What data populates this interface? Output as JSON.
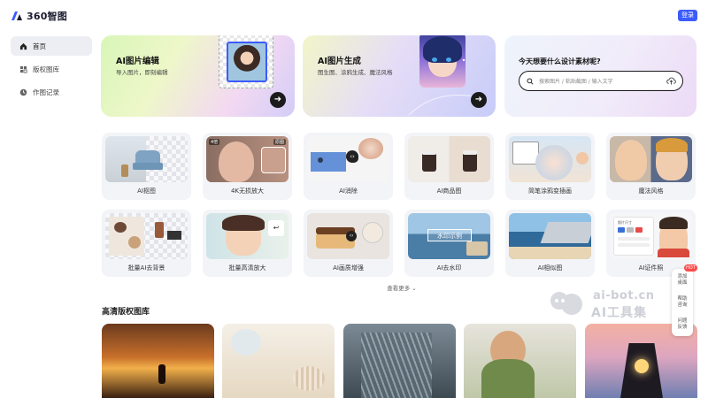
{
  "header": {
    "logo_text": "360智图",
    "login_label": "登录"
  },
  "sidebar": {
    "items": [
      {
        "label": "首页",
        "icon": "home-icon",
        "active": true
      },
      {
        "label": "版权图库",
        "icon": "grid-icon",
        "active": false
      },
      {
        "label": "作图记录",
        "icon": "clock-icon",
        "active": false
      }
    ]
  },
  "hero": {
    "edit": {
      "title": "AI图片编辑",
      "subtitle": "导入图片，即刻编辑"
    },
    "generate": {
      "title": "AI图片生成",
      "subtitle": "图生图、涂鸦生成、魔法风格"
    },
    "search": {
      "title": "今天想要什么设计素材呢?",
      "placeholder": "搜索图片 / 粘贴截图 / 输入文字"
    }
  },
  "tools": [
    {
      "label": "AI抠图"
    },
    {
      "label": "4K无损放大",
      "badge_left": "4倍",
      "badge_right": "原图"
    },
    {
      "label": "AI消除"
    },
    {
      "label": "AI商品图"
    },
    {
      "label": "简笔涂鸦变插画"
    },
    {
      "label": "魔法风格"
    },
    {
      "label": "批量AI去背景"
    },
    {
      "label": "批量高清放大"
    },
    {
      "label": "AI画质增强"
    },
    {
      "label": "AI去水印",
      "watermark_text": "水印示例"
    },
    {
      "label": "AI相似图"
    },
    {
      "label": "AI证件照",
      "form_text": "照片尺寸"
    }
  ],
  "more_label": "查看更多 ⌄",
  "gallery": {
    "title": "高清版权图库"
  },
  "float_bar": {
    "badge": "HOT",
    "items": [
      "添加桌面",
      "帮助咨询",
      "问题反馈"
    ]
  },
  "watermark": {
    "top": "ai-bot.cn",
    "bottom": "AI工具集"
  },
  "colors": {
    "accent": "#3b5bfd",
    "hot": "#ff4a4a"
  }
}
